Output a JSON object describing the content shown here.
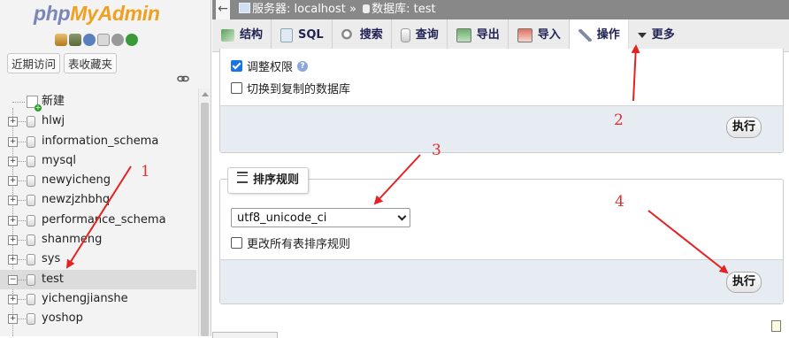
{
  "nav": {
    "logo_php": "php",
    "logo_myadmin": "MyAdmin",
    "tabs": [
      "近期访问",
      "表收藏夹"
    ],
    "new_label": "新建",
    "databases": [
      "hlwj",
      "information_schema",
      "mysql",
      "newyicheng",
      "newzjzhbhq",
      "performance_schema",
      "shanmeng",
      "sys",
      "test",
      "yichengjianshe",
      "yoshop"
    ],
    "selected_db": "test"
  },
  "breadcrumb": {
    "back": "←",
    "server_label": "服务器: localhost",
    "separator": "»",
    "database_label": "数据库: test"
  },
  "tabs": [
    {
      "label": "结构",
      "icon": "structure-icon"
    },
    {
      "label": "SQL",
      "icon": "sql-icon"
    },
    {
      "label": "搜索",
      "icon": "search-icon"
    },
    {
      "label": "查询",
      "icon": "query-icon"
    },
    {
      "label": "导出",
      "icon": "export-icon"
    },
    {
      "label": "导入",
      "icon": "import-icon"
    },
    {
      "label": "操作",
      "icon": "wrench-icon",
      "active": true
    },
    {
      "label": "更多",
      "icon": "chevron-down-icon"
    }
  ],
  "copy_panel": {
    "adjust_privileges_label": "调整权限",
    "adjust_privileges_checked": true,
    "switch_db_label": "切换到复制的数据库",
    "switch_db_checked": false,
    "execute_label": "执行"
  },
  "collation_panel": {
    "legend": "排序规则",
    "collation_value": "utf8_unicode_ci",
    "change_all_label": "更改所有表排序规则",
    "change_all_checked": false,
    "execute_label": "执行"
  },
  "annotations": [
    "1",
    "2",
    "3",
    "4"
  ],
  "colors": {
    "annotation_red": "#e52222",
    "breadcrumb_bg": "#888888",
    "panel_footer_bg": "#e6ecf2"
  }
}
